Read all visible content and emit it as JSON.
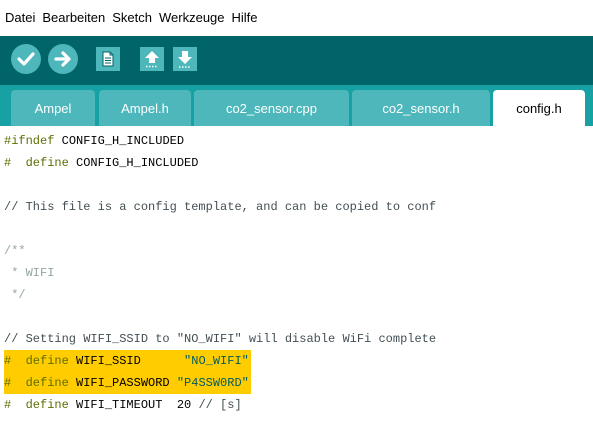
{
  "menu": [
    "Datei",
    "Bearbeiten",
    "Sketch",
    "Werkzeuge",
    "Hilfe"
  ],
  "toolbar": {
    "buttons": [
      {
        "name": "verify-button",
        "icon": "checkmark-icon"
      },
      {
        "name": "upload-button",
        "icon": "arrow-right-icon"
      },
      {
        "name": "new-button",
        "icon": "new-file-icon"
      },
      {
        "name": "open-button",
        "icon": "arrow-up-icon"
      },
      {
        "name": "save-button",
        "icon": "arrow-down-icon"
      }
    ]
  },
  "tabs": [
    {
      "label": "Ampel",
      "active": false
    },
    {
      "label": "Ampel.h",
      "active": false
    },
    {
      "label": "co2_sensor.cpp",
      "active": false
    },
    {
      "label": "co2_sensor.h",
      "active": false
    },
    {
      "label": "config.h",
      "active": true
    }
  ],
  "colors": {
    "toolbar_bg": "#006468",
    "tabbar_bg": "#17a1a5",
    "tab_bg": "#4db7bb",
    "highlight": "#ffcc00"
  },
  "code": [
    [
      {
        "t": "#ifndef",
        "c": "pp"
      },
      {
        "t": " CONFIG_H_INCLUDED",
        "c": "id"
      }
    ],
    [
      {
        "t": "#",
        "c": "pp"
      },
      {
        "t": "  define",
        "c": "pp"
      },
      {
        "t": " CONFIG_H_INCLUDED",
        "c": "id"
      }
    ],
    [],
    [
      {
        "t": "// This file is a config template, and can be copied to conf",
        "c": "cm"
      }
    ],
    [],
    [
      {
        "t": "/**",
        "c": "dc"
      }
    ],
    [
      {
        "t": " * WIFI",
        "c": "dc"
      }
    ],
    [
      {
        "t": " */",
        "c": "dc"
      }
    ],
    [],
    [
      {
        "t": "// Setting WIFI_SSID to \"NO_WIFI\" will disable WiFi complete",
        "c": "cm"
      }
    ],
    [
      {
        "t": "#",
        "c": "pp"
      },
      {
        "t": "  define",
        "c": "pp"
      },
      {
        "t": " WIFI_SSID",
        "c": "id"
      },
      {
        "t": "      ",
        "c": "id"
      },
      {
        "t": "\"NO_WIFI\"",
        "c": "str"
      }
    ],
    [
      {
        "t": "#",
        "c": "pp"
      },
      {
        "t": "  define",
        "c": "pp"
      },
      {
        "t": " WIFI_PASSWORD",
        "c": "id"
      },
      {
        "t": " ",
        "c": "id"
      },
      {
        "t": "\"P4SSW0RD\"",
        "c": "str"
      }
    ],
    [
      {
        "t": "#",
        "c": "pp"
      },
      {
        "t": "  define",
        "c": "pp"
      },
      {
        "t": " WIFI_TIMEOUT",
        "c": "id"
      },
      {
        "t": "  20",
        "c": "num"
      },
      {
        "t": " // [s]",
        "c": "cm"
      }
    ]
  ],
  "highlighted_lines": [
    10,
    11
  ]
}
